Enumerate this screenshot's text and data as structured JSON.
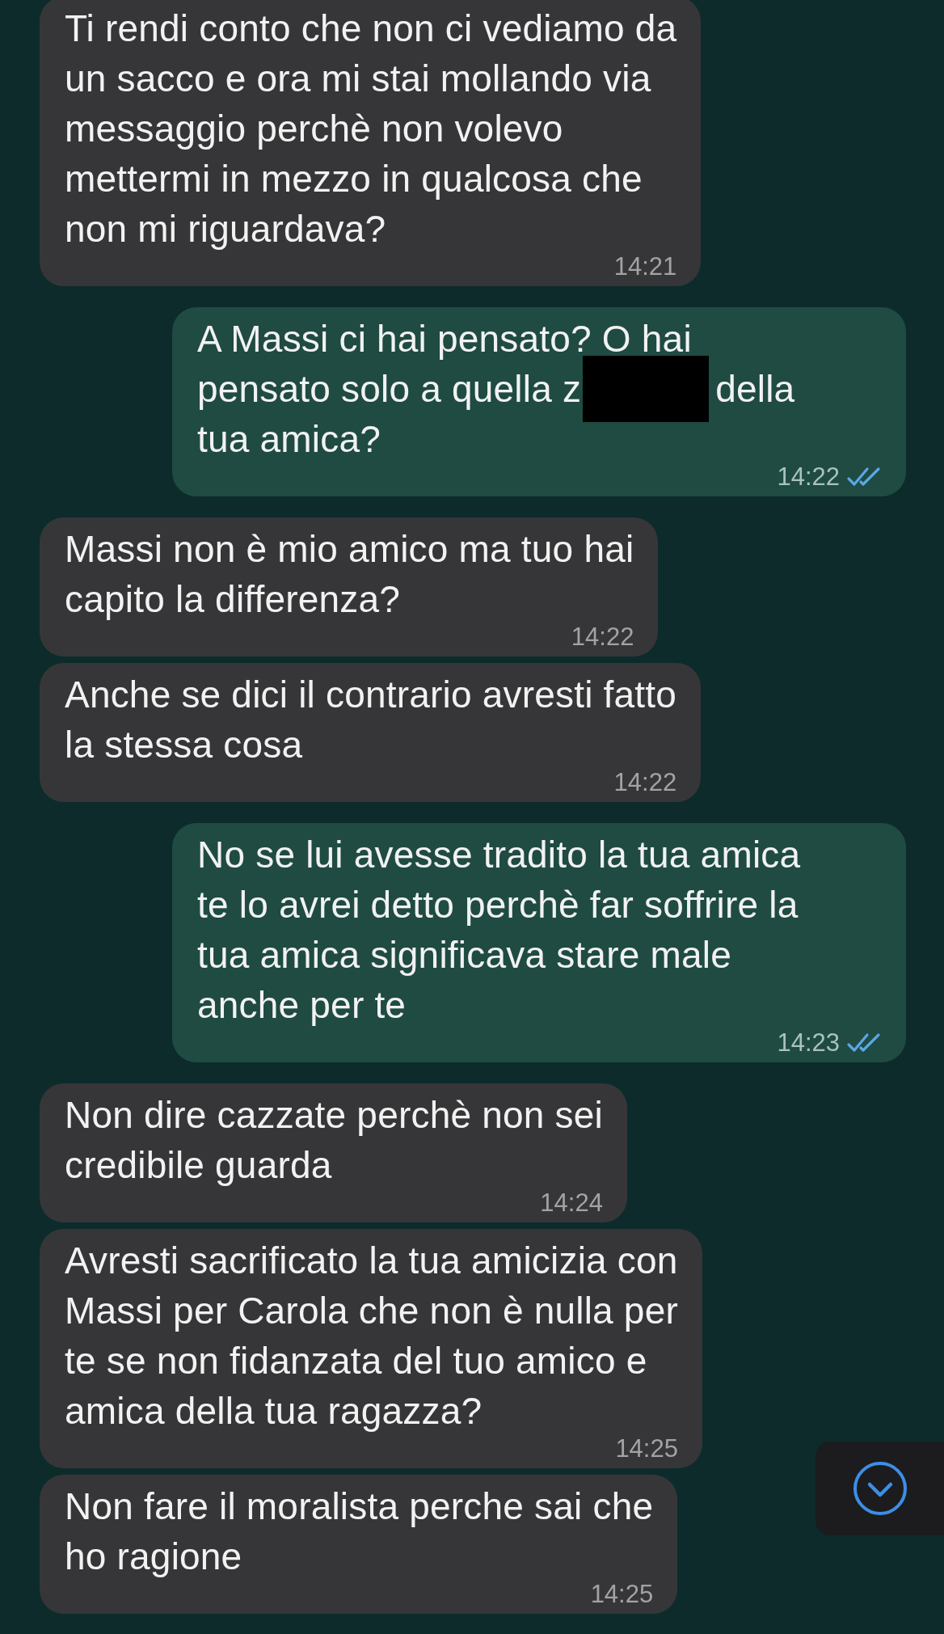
{
  "messages": [
    {
      "kind": "incoming",
      "text": "Ti rendi conto che non ci vediamo da\nun sacco e ora mi stai mollando via\nmessaggio perchè non volevo\nmettermi in mezzo in qualcosa che\nnon mi riguardava?",
      "time": "14:21"
    },
    {
      "kind": "outgoing",
      "lines": [
        [
          {
            "kind": "text",
            "text": "A Massi ci hai pensato? O hai"
          }
        ],
        [
          {
            "kind": "text",
            "text": "pensato solo a quella z"
          },
          {
            "kind": "redaction"
          },
          {
            "kind": "text",
            "text": "della"
          }
        ],
        [
          {
            "kind": "text",
            "text": "tua amica?"
          }
        ]
      ],
      "time": "14:22",
      "read": true
    },
    {
      "kind": "incoming",
      "text": "Massi non è mio amico ma tuo hai\ncapito la differenza?",
      "time": "14:22"
    },
    {
      "kind": "incoming",
      "text": "Anche se dici il contrario avresti fatto\nla stessa cosa",
      "time": "14:22"
    },
    {
      "kind": "outgoing",
      "text": "No se lui avesse tradito la tua amica\nte lo avrei detto perchè far soffrire la\ntua amica significava stare male\nanche per te",
      "time": "14:23",
      "read": true
    },
    {
      "kind": "incoming",
      "text": "Non dire cazzate perchè non sei\ncredibile guarda",
      "time": "14:24"
    },
    {
      "kind": "incoming",
      "text": "Avresti sacrificato la tua amicizia con\nMassi per Carola che non è nulla per\nte se non fidanzata del tuo amico e\namica della tua ragazza?",
      "time": "14:25"
    },
    {
      "kind": "incoming",
      "text": "Non fare il moralista perche sai che\nho ragione",
      "time": "14:25"
    }
  ],
  "scroll_button": {
    "visible": true
  }
}
